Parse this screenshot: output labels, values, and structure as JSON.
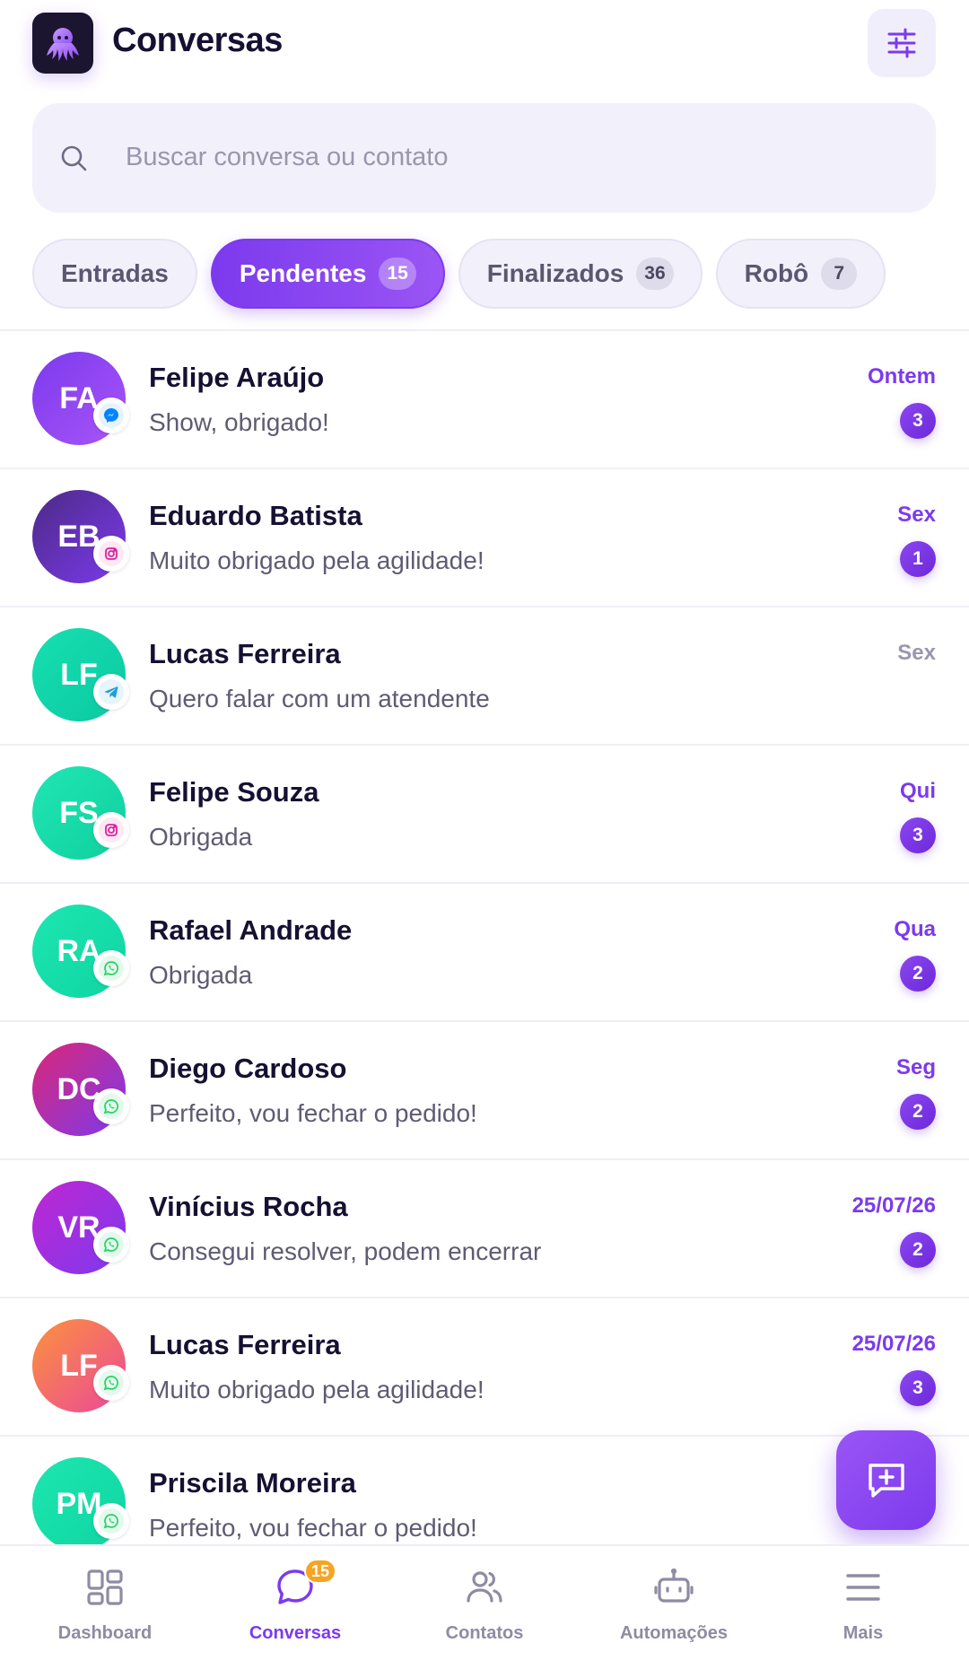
{
  "app": {
    "title": "Conversas"
  },
  "search": {
    "placeholder": "Buscar conversa ou contato",
    "value": ""
  },
  "tabs": [
    {
      "label": "Entradas",
      "count": "",
      "active": false
    },
    {
      "label": "Pendentes",
      "count": "15",
      "active": true
    },
    {
      "label": "Finalizados",
      "count": "36",
      "active": false
    },
    {
      "label": "Robô",
      "count": "7",
      "active": false
    }
  ],
  "conversations": [
    {
      "initials": "FA",
      "name": "Felipe Araújo",
      "message": "Show, obrigado!",
      "time": "Ontem",
      "unread": "3",
      "channel": "messenger-icon"
    },
    {
      "initials": "EB",
      "name": "Eduardo Batista",
      "message": "Muito obrigado pela agilidade!",
      "time": "Sex",
      "unread": "1",
      "channel": "instagram-icon"
    },
    {
      "initials": "LF",
      "name": "Lucas Ferreira",
      "message": "Quero falar com um atendente",
      "time": "Sex",
      "unread": "",
      "channel": "telegram-icon"
    },
    {
      "initials": "FS",
      "name": "Felipe Souza",
      "message": "Obrigada",
      "time": "Qui",
      "unread": "3",
      "channel": "instagram-icon"
    },
    {
      "initials": "RA",
      "name": "Rafael Andrade",
      "message": "Obrigada",
      "time": "Qua",
      "unread": "2",
      "channel": "whatsapp-icon"
    },
    {
      "initials": "DC",
      "name": "Diego Cardoso",
      "message": "Perfeito, vou fechar o pedido!",
      "time": "Seg",
      "unread": "2",
      "channel": "whatsapp-icon"
    },
    {
      "initials": "VR",
      "name": "Vinícius Rocha",
      "message": "Consegui resolver, podem encerrar",
      "time": "25/07/26",
      "unread": "2",
      "channel": "whatsapp-icon"
    },
    {
      "initials": "LF",
      "name": "Lucas Ferreira",
      "message": "Muito obrigado pela agilidade!",
      "time": "25/07/26",
      "unread": "3",
      "channel": "whatsapp-icon"
    },
    {
      "initials": "PM",
      "name": "Priscila Moreira",
      "message": "Perfeito, vou fechar o pedido!",
      "time": "",
      "unread": "",
      "channel": "whatsapp-icon"
    }
  ],
  "colors": {
    "accent": "#7c3aed",
    "muted": "#9a96ad",
    "badge": "#f5a524",
    "whatsapp": "#25d366",
    "instagram": "#d6249f",
    "messenger": "#0084ff",
    "telegram": "#229ed9"
  },
  "nav": [
    {
      "label": "Dashboard",
      "icon": "dashboard-icon",
      "active": false,
      "badge": ""
    },
    {
      "label": "Conversas",
      "icon": "chat-bubble-icon",
      "active": true,
      "badge": "15"
    },
    {
      "label": "Contatos",
      "icon": "contacts-icon",
      "active": false,
      "badge": ""
    },
    {
      "label": "Automações",
      "icon": "robot-icon",
      "active": false,
      "badge": ""
    },
    {
      "label": "Mais",
      "icon": "menu-icon",
      "active": false,
      "badge": ""
    }
  ]
}
